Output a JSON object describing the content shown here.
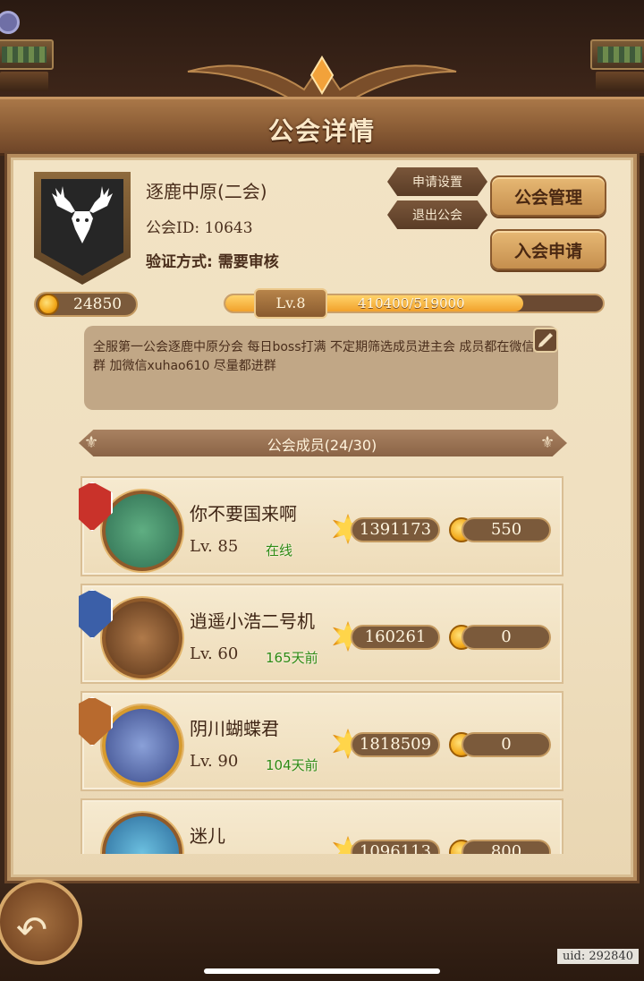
{
  "header": {
    "title": "公会详情"
  },
  "guild": {
    "name": "逐鹿中原(二会)",
    "id_text": "公会ID: 10643",
    "verify_text": "验证方式: 需要审核",
    "gold": "24850",
    "level_label": "Lv.8",
    "exp_text": "410400/519000",
    "exp_fraction": 0.79,
    "description": "全服第一公会逐鹿中原分会 每日boss打满 不定期筛选成员进主会 成员都在微信群 加微信xuhao610 尽量都进群"
  },
  "buttons": {
    "apply_settings": "申请设置",
    "leave_guild": "退出公会",
    "guild_manage": "公会管理",
    "join_requests": "入会申请"
  },
  "members_section": {
    "title": "公会成员(24/30)"
  },
  "members": [
    {
      "name": "你不要国来啊",
      "level": "Lv. 85",
      "status": "在线",
      "power": "1391173",
      "contribution": "550",
      "badge_color": "#c9322a",
      "avatar_color": "#3f8a6a"
    },
    {
      "name": "逍遥小浩二号机",
      "level": "Lv. 60",
      "status": "165天前",
      "power": "160261",
      "contribution": "0",
      "badge_color": "#3b5fa8",
      "avatar_color": "#7a4a2a"
    },
    {
      "name": "阴川蝴蝶君",
      "level": "Lv. 90",
      "status": "104天前",
      "power": "1818509",
      "contribution": "0",
      "badge_color": "#b86a2e",
      "avatar_color": "#4a5aa8"
    },
    {
      "name": "迷儿",
      "level": "",
      "status": "",
      "power": "1096113",
      "contribution": "800",
      "badge_color": "",
      "avatar_color": "#3a8ab8"
    }
  ],
  "footer": {
    "uid": "uid: 292840"
  },
  "colors": {
    "accent_gold": "#f1a12b",
    "panel": "#efdfbf",
    "online_green": "#2e8a12"
  }
}
